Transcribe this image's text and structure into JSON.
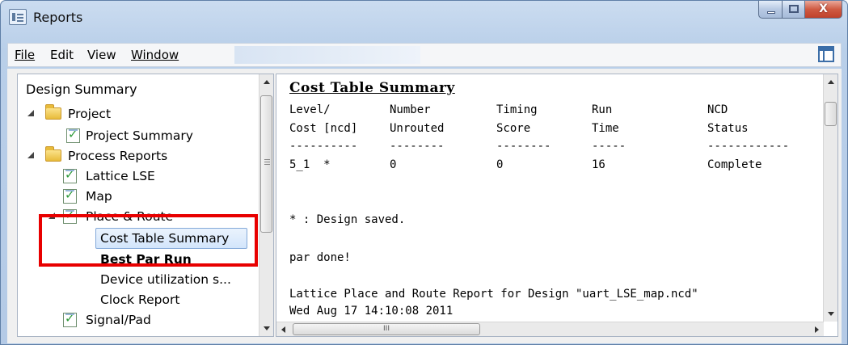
{
  "window": {
    "title": "Reports",
    "close_glyph": "X"
  },
  "menu": {
    "file": "File",
    "edit": "Edit",
    "view": "View",
    "window": "Window"
  },
  "tree": {
    "header": "Design Summary",
    "items": [
      {
        "label": "Project",
        "icon": "folder-icon"
      },
      {
        "label": "Project Summary",
        "icon": "report-icon"
      },
      {
        "label": "Process Reports",
        "icon": "folder-icon"
      },
      {
        "label": "Lattice LSE",
        "icon": "report-icon"
      },
      {
        "label": "Map",
        "icon": "report-icon"
      },
      {
        "label": "Place & Route",
        "icon": "report-icon"
      },
      {
        "label": "Cost Table Summary",
        "selected": true
      },
      {
        "label": "Best Par Run"
      },
      {
        "label": "Device utilization s..."
      },
      {
        "label": "Clock Report"
      },
      {
        "label": "Signal/Pad",
        "icon": "report-icon"
      }
    ],
    "splitter_glyph": "≡"
  },
  "report": {
    "title": "Cost Table Summary",
    "headers_line1": [
      "Level/",
      "Number",
      "Timing",
      "Run",
      "NCD"
    ],
    "headers_line2": [
      "Cost [ncd]",
      "Unrouted",
      "Score",
      "Time",
      "Status"
    ],
    "separators": [
      "----------",
      "--------",
      "--------",
      "-----",
      "------------"
    ],
    "row": [
      "5_1  *",
      "0",
      "0",
      "16",
      "Complete"
    ],
    "note": "* : Design saved.",
    "par_done": "par done!",
    "footer_line": "Lattice Place and Route Report for Design \"uart_LSE_map.ncd\"",
    "date_line": "Wed Aug 17 14:10:08 2011",
    "hscroll_grip": "III"
  },
  "colors": {
    "highlight": "#e80000",
    "title_bar": "#b9cfe9",
    "selection": "#d3e5fb"
  }
}
